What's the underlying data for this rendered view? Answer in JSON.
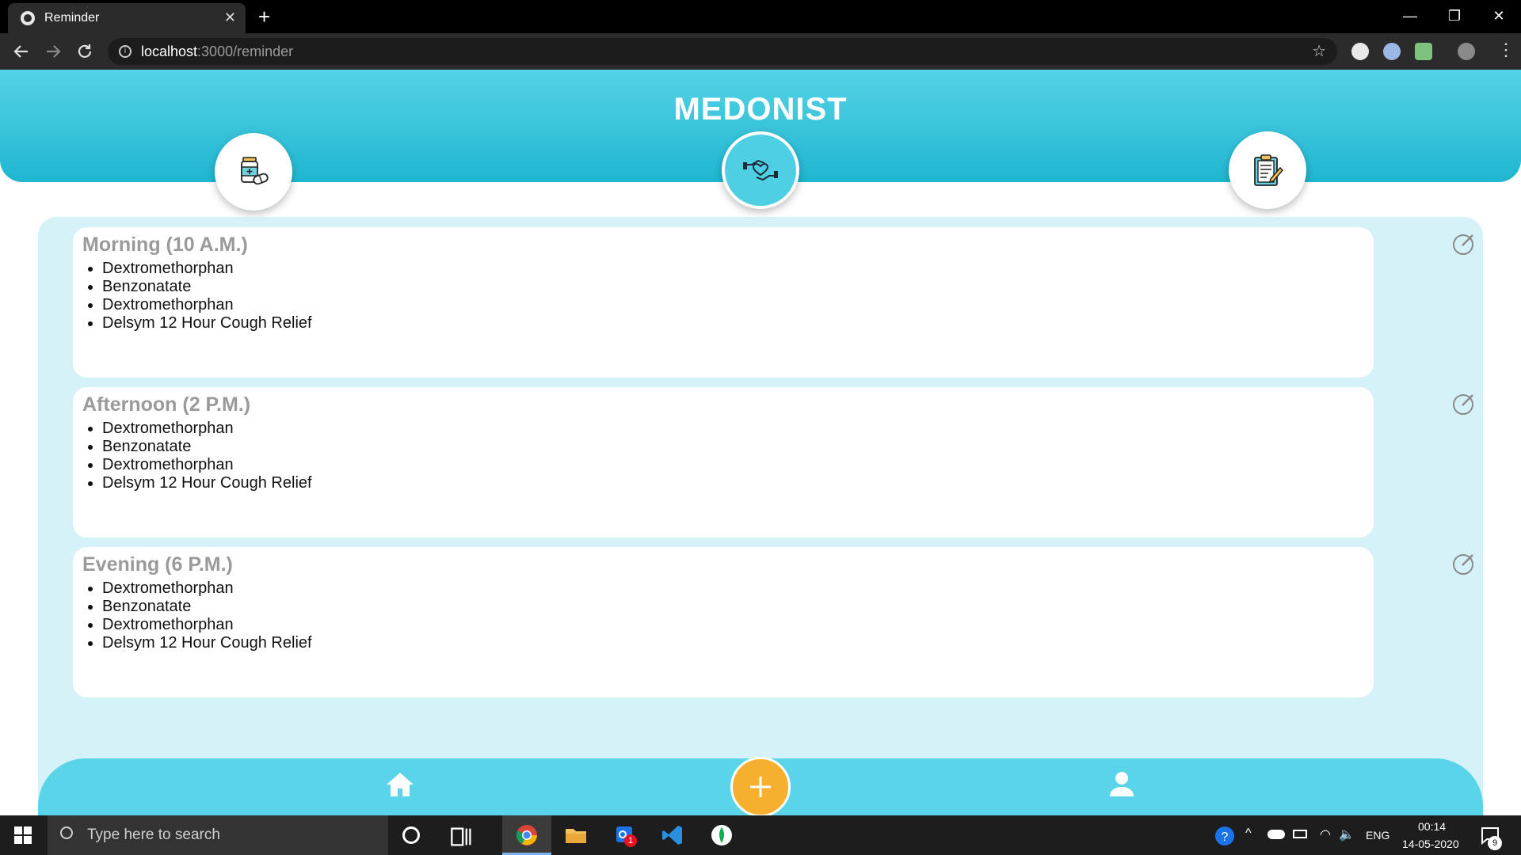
{
  "browser": {
    "tab_title": "Reminder",
    "url_host": "localhost",
    "url_path": ":3000/reminder",
    "window_controls": {
      "minimize": "—",
      "restore": "❐",
      "close": "✕"
    },
    "new_tab": "+",
    "tab_close": "✕"
  },
  "app": {
    "brand": "MEDONIST",
    "top_nav": [
      {
        "name": "medicine-icon"
      },
      {
        "name": "care-hands-icon",
        "active": true
      },
      {
        "name": "clipboard-icon"
      }
    ],
    "reminders": [
      {
        "title": "Morning (10 A.M.)",
        "medicines": [
          "Dextromethorphan",
          "Benzonatate",
          "Dextromethorphan",
          "Delsym 12 Hour Cough Relief"
        ]
      },
      {
        "title": "Afternoon (2 P.M.)",
        "medicines": [
          "Dextromethorphan",
          "Benzonatate",
          "Dextromethorphan",
          "Delsym 12 Hour Cough Relief"
        ]
      },
      {
        "title": "Evening (6 P.M.)",
        "medicines": [
          "Dextromethorphan",
          "Benzonatate",
          "Dextromethorphan",
          "Delsym 12 Hour Cough Relief"
        ]
      }
    ],
    "bottom_nav": {
      "home": "home-icon",
      "add": "plus-icon",
      "profile": "user-icon"
    },
    "colors": {
      "header": "#55d3e6",
      "panel": "#d5f2f9",
      "title_gray": "#9a9a9a",
      "add_button": "#f6b02e"
    }
  },
  "taskbar": {
    "search_placeholder": "Type here to search",
    "language": "ENG",
    "time": "00:14",
    "date": "14-05-2020",
    "notification_count": "9",
    "outlook_badge": "1"
  }
}
